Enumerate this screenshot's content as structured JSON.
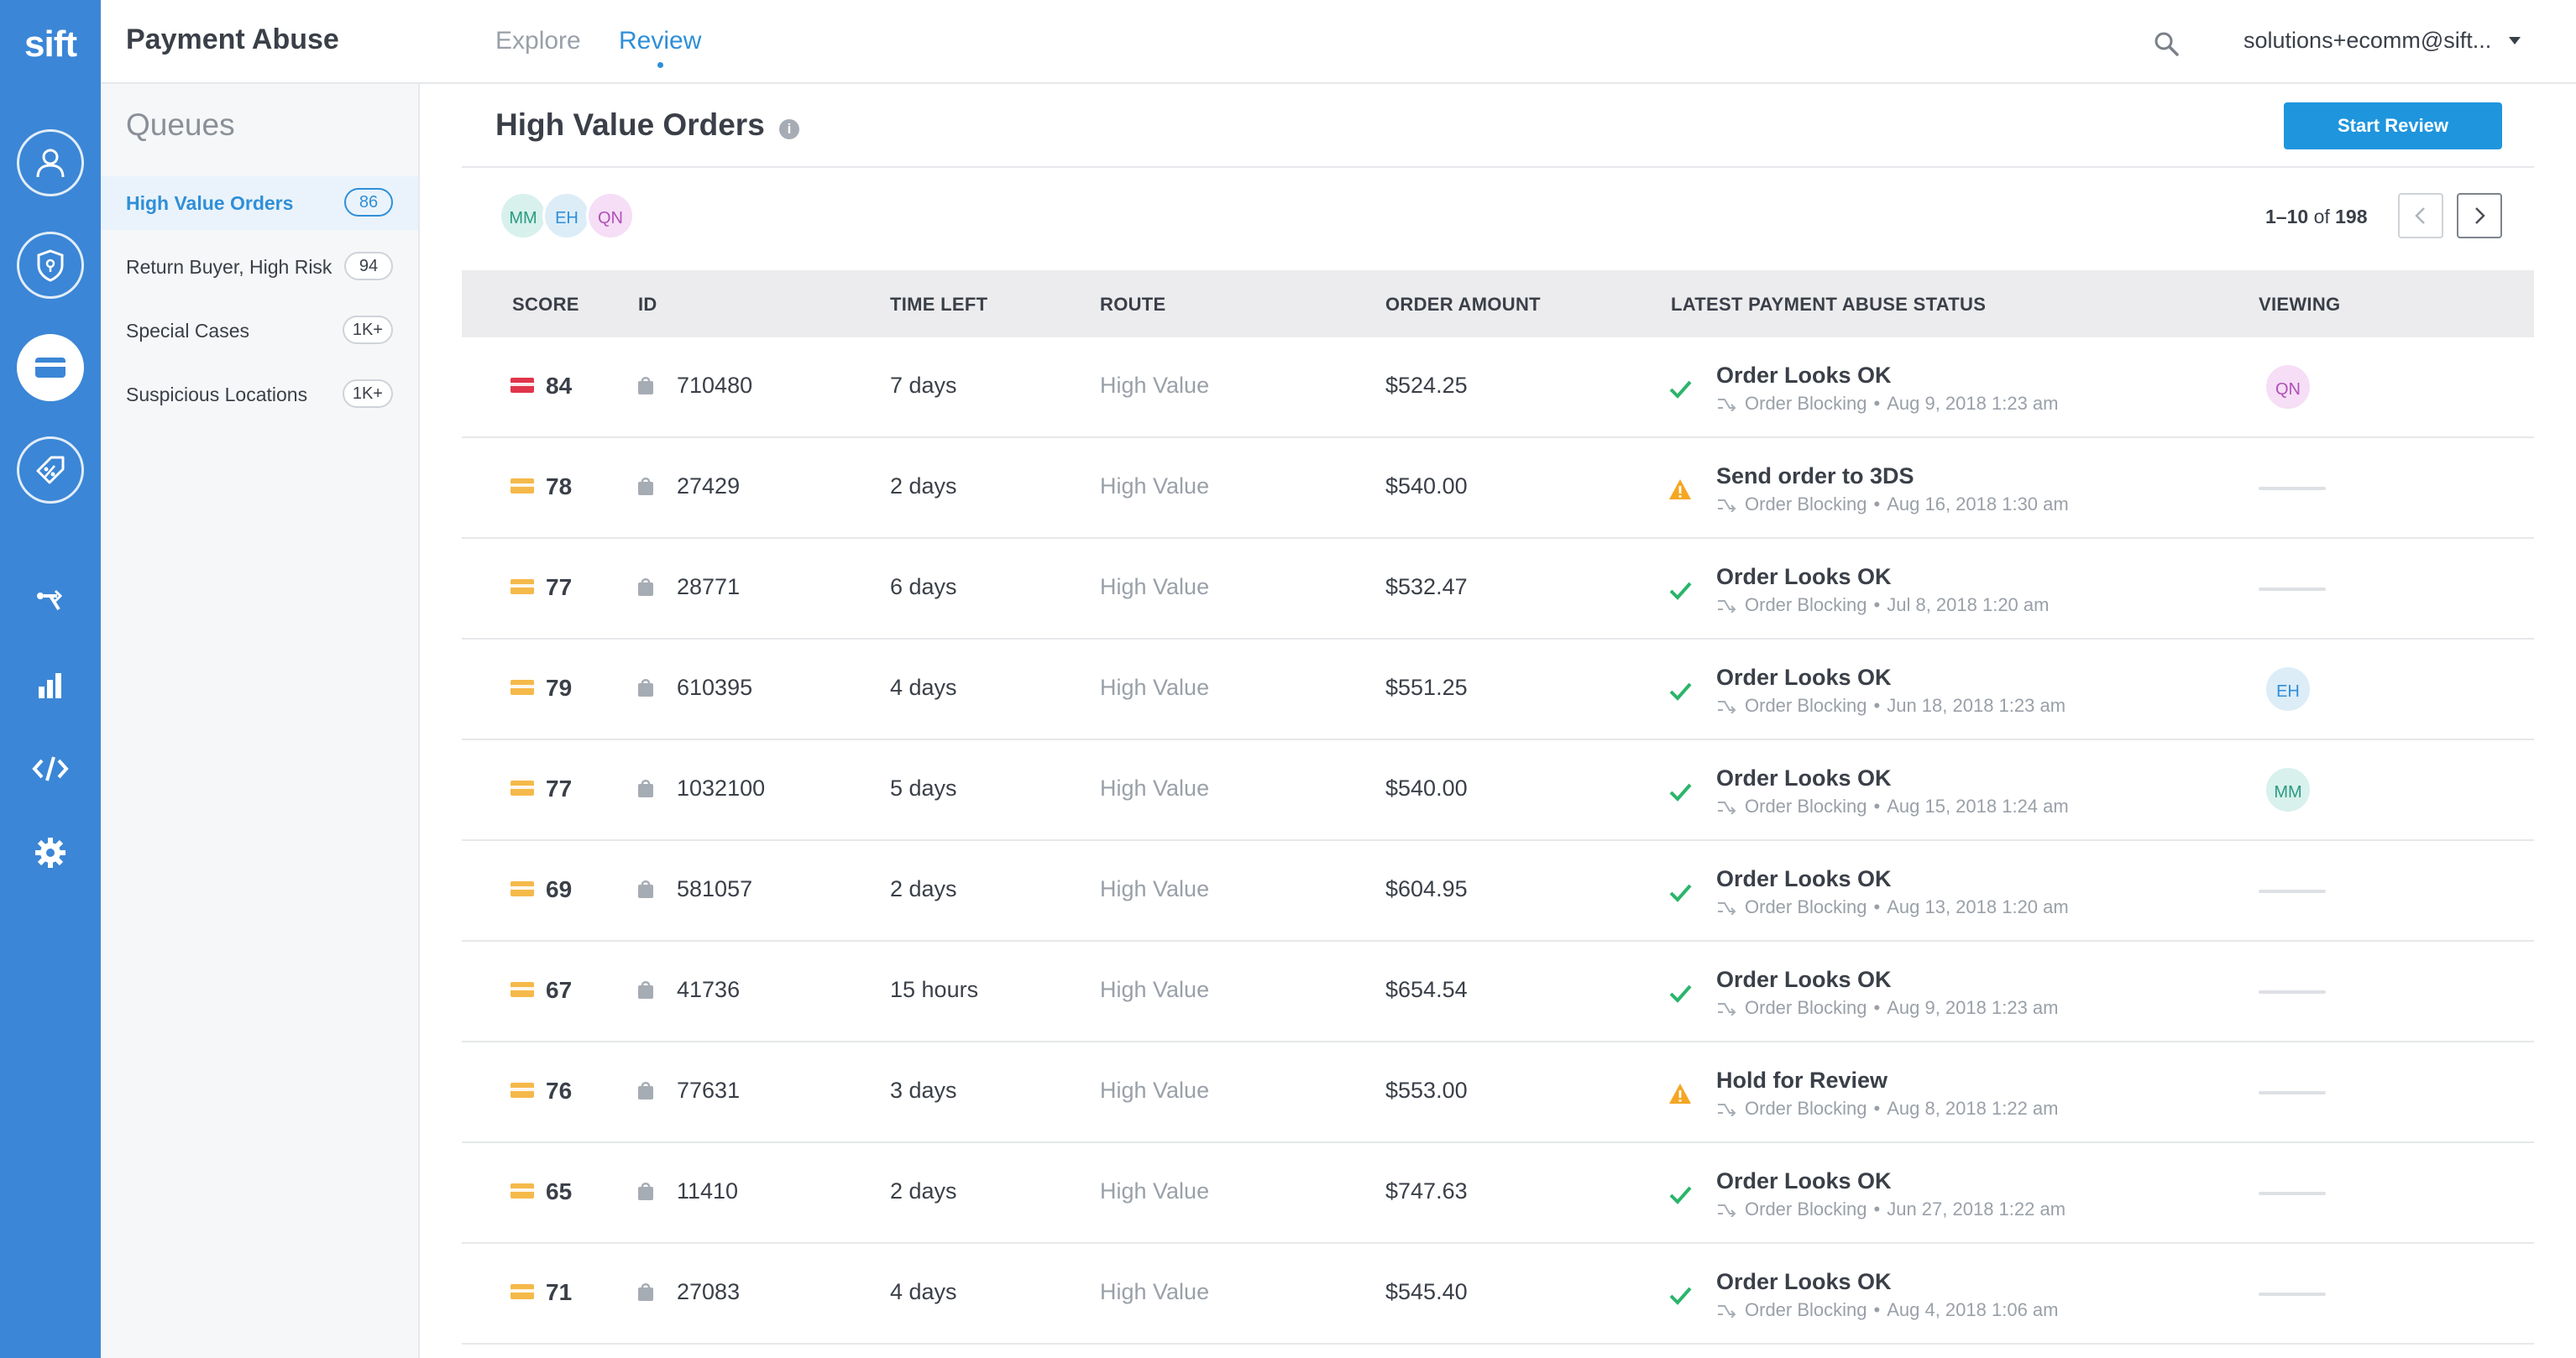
{
  "app": {
    "logo": "sift",
    "title": "Payment Abuse"
  },
  "nav": {
    "tabs": [
      {
        "label": "Explore"
      },
      {
        "label": "Review"
      }
    ],
    "active_tab": "Review"
  },
  "account": {
    "label": "solutions+ecomm@sift..."
  },
  "rail_icons": [
    "user-icon",
    "shield-icon",
    "credit-card-icon",
    "tag-percent-icon",
    "workflow-icon",
    "bar-chart-icon",
    "code-icon",
    "gear-icon"
  ],
  "queues": {
    "title": "Queues",
    "items": [
      {
        "label": "High Value Orders",
        "count": "86"
      },
      {
        "label": "Return Buyer, High Risk",
        "count": "94"
      },
      {
        "label": "Special Cases",
        "count": "1K+"
      },
      {
        "label": "Suspicious Locations",
        "count": "1K+"
      }
    ]
  },
  "main": {
    "title": "High Value Orders",
    "info_symbol": "i",
    "start_review_label": "Start Review",
    "reviewers": [
      "MM",
      "EH",
      "QN"
    ],
    "pager": {
      "range": "1–10",
      "of_label": "of",
      "total": "198"
    }
  },
  "table": {
    "columns": [
      "SCORE",
      "ID",
      "TIME LEFT",
      "ROUTE",
      "ORDER AMOUNT",
      "LATEST PAYMENT ABUSE STATUS",
      "VIEWING"
    ],
    "rows": [
      {
        "score": "84",
        "score_level": "high",
        "id": "710480",
        "time_left": "7 days",
        "route": "High Value",
        "amount": "$524.25",
        "status": "Order Looks OK",
        "status_type": "ok",
        "workflow": "Order Blocking",
        "date": "Aug 9, 2018 1:23 am",
        "viewing": "QN"
      },
      {
        "score": "78",
        "score_level": "medium",
        "id": "27429",
        "time_left": "2 days",
        "route": "High Value",
        "amount": "$540.00",
        "status": "Send order to 3DS",
        "status_type": "warning",
        "workflow": "Order Blocking",
        "date": "Aug 16, 2018 1:30 am",
        "viewing": ""
      },
      {
        "score": "77",
        "score_level": "medium",
        "id": "28771",
        "time_left": "6 days",
        "route": "High Value",
        "amount": "$532.47",
        "status": "Order Looks OK",
        "status_type": "ok",
        "workflow": "Order Blocking",
        "date": "Jul 8, 2018 1:20 am",
        "viewing": ""
      },
      {
        "score": "79",
        "score_level": "medium",
        "id": "610395",
        "time_left": "4 days",
        "route": "High Value",
        "amount": "$551.25",
        "status": "Order Looks OK",
        "status_type": "ok",
        "workflow": "Order Blocking",
        "date": "Jun 18, 2018 1:23 am",
        "viewing": "EH"
      },
      {
        "score": "77",
        "score_level": "medium",
        "id": "1032100",
        "time_left": "5 days",
        "route": "High Value",
        "amount": "$540.00",
        "status": "Order Looks OK",
        "status_type": "ok",
        "workflow": "Order Blocking",
        "date": "Aug 15, 2018 1:24 am",
        "viewing": "MM"
      },
      {
        "score": "69",
        "score_level": "medium",
        "id": "581057",
        "time_left": "2 days",
        "route": "High Value",
        "amount": "$604.95",
        "status": "Order Looks OK",
        "status_type": "ok",
        "workflow": "Order Blocking",
        "date": "Aug 13, 2018 1:20 am",
        "viewing": ""
      },
      {
        "score": "67",
        "score_level": "medium",
        "id": "41736",
        "time_left": "15 hours",
        "route": "High Value",
        "amount": "$654.54",
        "status": "Order Looks OK",
        "status_type": "ok",
        "workflow": "Order Blocking",
        "date": "Aug 9, 2018 1:23 am",
        "viewing": ""
      },
      {
        "score": "76",
        "score_level": "medium",
        "id": "77631",
        "time_left": "3 days",
        "route": "High Value",
        "amount": "$553.00",
        "status": "Hold for Review",
        "status_type": "warning",
        "workflow": "Order Blocking",
        "date": "Aug 8, 2018 1:22 am",
        "viewing": ""
      },
      {
        "score": "65",
        "score_level": "medium",
        "id": "11410",
        "time_left": "2 days",
        "route": "High Value",
        "amount": "$747.63",
        "status": "Order Looks OK",
        "status_type": "ok",
        "workflow": "Order Blocking",
        "date": "Jun 27, 2018 1:22 am",
        "viewing": ""
      },
      {
        "score": "71",
        "score_level": "medium",
        "id": "27083",
        "time_left": "4 days",
        "route": "High Value",
        "amount": "$545.40",
        "status": "Order Looks OK",
        "status_type": "ok",
        "workflow": "Order Blocking",
        "date": "Aug 4, 2018 1:06 am",
        "viewing": ""
      }
    ]
  },
  "colors": {
    "rail": "#3b86d6",
    "accent": "#2f8fd8",
    "button": "#1f95dd",
    "score_high": "#e0354a",
    "score_medium": "#f5b94a",
    "ok": "#2bb56b",
    "warning": "#f5a623"
  }
}
